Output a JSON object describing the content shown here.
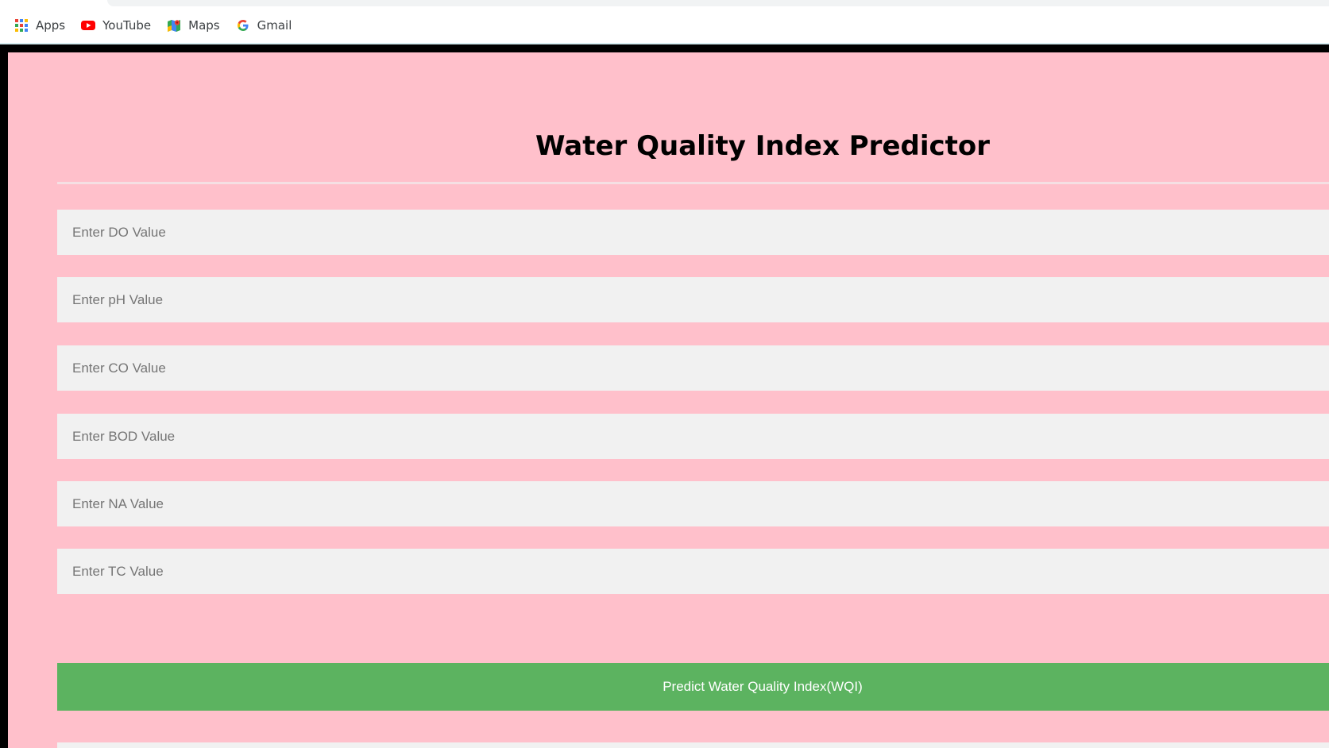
{
  "bookmarks_bar": {
    "items": [
      {
        "label": "Apps",
        "icon": "apps-grid-icon"
      },
      {
        "label": "YouTube",
        "icon": "youtube-icon"
      },
      {
        "label": "Maps",
        "icon": "maps-icon"
      },
      {
        "label": "Gmail",
        "icon": "google-g-icon"
      }
    ]
  },
  "form": {
    "title": "Water Quality Index Predictor",
    "fields": [
      {
        "placeholder": "Enter DO Value",
        "value": ""
      },
      {
        "placeholder": "Enter pH Value",
        "value": ""
      },
      {
        "placeholder": "Enter CO Value",
        "value": ""
      },
      {
        "placeholder": "Enter BOD Value",
        "value": ""
      },
      {
        "placeholder": "Enter NA Value",
        "value": ""
      },
      {
        "placeholder": "Enter TC Value",
        "value": ""
      }
    ],
    "submit_label": "Predict Water Quality Index(WQI)"
  },
  "colors": {
    "page_background": "#ffc0cb",
    "input_background": "#f1f1f1",
    "button_background": "#5cb360",
    "button_text": "#ffffff"
  }
}
